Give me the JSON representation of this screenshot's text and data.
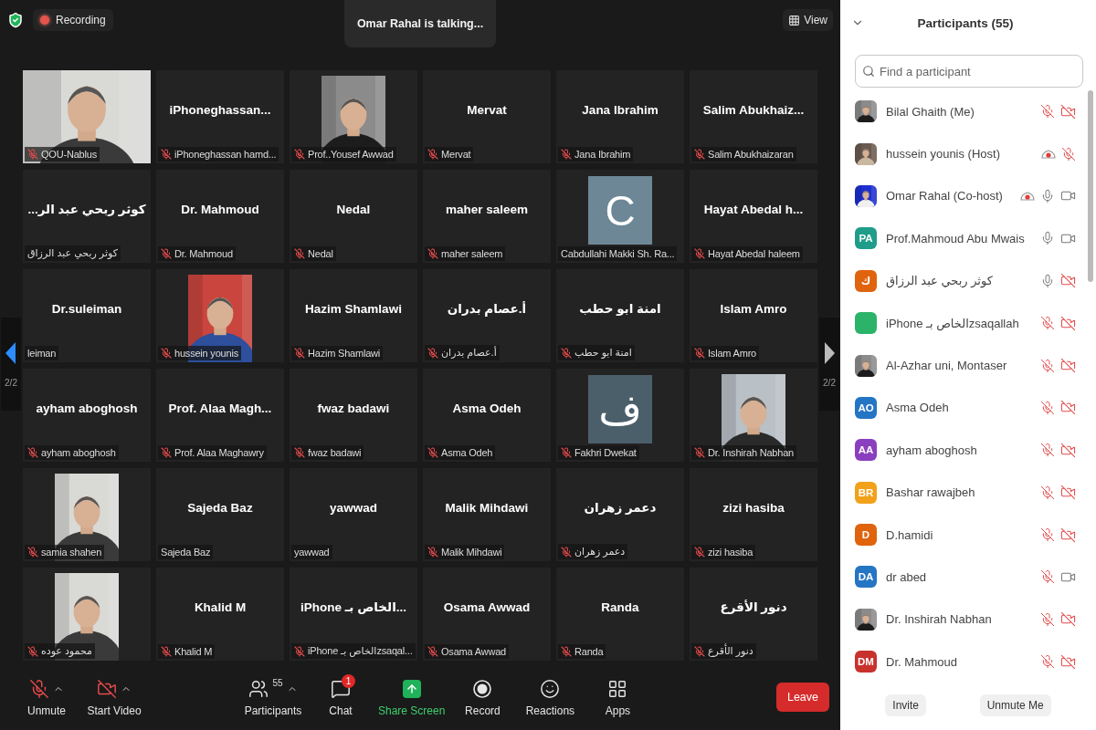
{
  "top_bar": {
    "recording": "Recording",
    "talking": "Omar Rahal is talking...",
    "view": "View"
  },
  "gallery": {
    "page_left": "2/2",
    "page_right": "2/2",
    "tiles": [
      {
        "kind": "video",
        "label": "QOU-Nablus",
        "muted": true
      },
      {
        "kind": "name",
        "title": "iPhoneghassan...",
        "label": "iPhoneghassan hamd...",
        "muted": true
      },
      {
        "label": "Prof..Yousef Awwad",
        "muted": true
      },
      {
        "kind": "name",
        "title": "Mervat",
        "label": "Mervat",
        "muted": true
      },
      {
        "kind": "name",
        "title": "Jana Ibrahim",
        "label": "Jana Ibrahim",
        "muted": true
      },
      {
        "kind": "name",
        "title": "Salim  Abukhaiz...",
        "label": "Salim Abukhaizaran",
        "muted": true
      },
      {
        "kind": "name",
        "title": "...كوثر ربحي عبد الر",
        "label": "كوثر ربحي عبد الرزاق",
        "muted": false
      },
      {
        "kind": "name",
        "title": "Dr. Mahmoud",
        "label": "Dr. Mahmoud",
        "muted": true
      },
      {
        "kind": "name",
        "title": "Nedal",
        "label": "Nedal",
        "muted": true
      },
      {
        "kind": "name",
        "title": "maher saleem",
        "label": "maher saleem",
        "muted": true
      },
      {
        "kind": "avatar",
        "letter": "C",
        "color": "#6e8796",
        "label": "Cabdullahi Makki Sh. Ra...",
        "muted": false
      },
      {
        "kind": "name",
        "title": "Hayat Abedal h...",
        "label": "Hayat Abedal haleem",
        "muted": true
      },
      {
        "kind": "name",
        "title": "Dr.suleiman",
        "label": "leiman",
        "muted": false
      },
      {
        "label": "hussein younis",
        "muted": true
      },
      {
        "kind": "name",
        "title": "Hazim Shamlawi",
        "label": "Hazim Shamlawi",
        "muted": true
      },
      {
        "kind": "name",
        "title": "أ.عصام بدران",
        "label": "أ.عصام بدران",
        "muted": true
      },
      {
        "kind": "name",
        "title": "امنة ابو حطب",
        "label": "امنة ابو حطب",
        "muted": true
      },
      {
        "kind": "name",
        "title": "Islam Amro",
        "label": "Islam Amro",
        "muted": true
      },
      {
        "kind": "name",
        "title": "ayham aboghosh",
        "label": "ayham aboghosh",
        "muted": true
      },
      {
        "kind": "name",
        "title": "Prof. Alaa  Magh...",
        "label": "Prof. Alaa Maghawry",
        "muted": true
      },
      {
        "kind": "name",
        "title": "fwaz badawi",
        "label": "fwaz badawi",
        "muted": true
      },
      {
        "kind": "name",
        "title": "Asma Odeh",
        "label": "Asma Odeh",
        "muted": true
      },
      {
        "kind": "avatar",
        "letter": "ف",
        "color": "#4b5f6b",
        "label": "Fakhri Dwekat",
        "muted": true
      },
      {
        "label": "Dr. Inshirah Nabhan",
        "muted": true
      },
      {
        "label": "samia shahen",
        "muted": true
      },
      {
        "kind": "name",
        "title": "Sajeda Baz",
        "label": "Sajeda Baz",
        "muted": false
      },
      {
        "kind": "name",
        "title": "yawwad",
        "label": "yawwad",
        "muted": false
      },
      {
        "kind": "name",
        "title": "Malik Mihdawi",
        "label": "Malik Mihdawi",
        "muted": true
      },
      {
        "kind": "name",
        "title": "دعمر زهران",
        "label": "دعمر زهران",
        "muted": true
      },
      {
        "kind": "name",
        "title": "zizi hasiba",
        "label": "zizi hasiba",
        "muted": true
      },
      {
        "label": "محمود عوده",
        "muted": true
      },
      {
        "kind": "name",
        "title": "Khalid M",
        "label": "Khalid M",
        "muted": true
      },
      {
        "kind": "name",
        "title": "iPhone الخاص بـ...",
        "label": "iPhone الخاص بـzsaqal...",
        "muted": true
      },
      {
        "kind": "name",
        "title": "Osama Awwad",
        "label": "Osama Awwad",
        "muted": true
      },
      {
        "kind": "name",
        "title": "Randa",
        "label": "Randa",
        "muted": true
      },
      {
        "kind": "name",
        "title": "دنور الأقرع",
        "label": "دنور الأقرع",
        "muted": true
      }
    ]
  },
  "toolbar": {
    "buttons": [
      {
        "kind": "audio",
        "label": "Unmute",
        "caret": true
      },
      {
        "kind": "video",
        "label": "Start Video",
        "caret": true
      },
      {
        "kind": "participants",
        "label": "Participants",
        "count": "55",
        "caret": true
      },
      {
        "kind": "chat",
        "label": "Chat",
        "badge": "1"
      },
      {
        "kind": "share",
        "label": "Share Screen"
      },
      {
        "kind": "record",
        "label": "Record"
      },
      {
        "kind": "reactions",
        "label": "Reactions"
      },
      {
        "kind": "apps",
        "label": "Apps"
      }
    ],
    "leave": "Leave"
  },
  "participants_panel": {
    "title": "Participants (55)",
    "search": {
      "placeholder": "Find a participant"
    },
    "people": [
      {
        "name": "Bilal Ghaith (Me)",
        "recording": false,
        "muted": true,
        "video_off": true
      },
      {
        "name": "hussein younis (Host)",
        "recording": true,
        "muted": true
      },
      {
        "name": "Omar Rahal (Co-host)",
        "recording": true,
        "muted": false,
        "video_off": false
      },
      {
        "name": "Prof.Mahmoud Abu Mwais",
        "kind": "initials",
        "initials": "PA",
        "color": "#1f9d8a",
        "recording": false,
        "muted": false,
        "video_off": false
      },
      {
        "name": "كوثر ربحي عبد الرزاق",
        "kind": "initials",
        "initials": "ك",
        "color": "#e0630d",
        "recording": false,
        "muted": false,
        "video_off": true
      },
      {
        "name": " iPhone الخاص بـzsaqallah",
        "kind": "initials",
        "color": "#2bb36a",
        "recording": false,
        "muted": true,
        "video_off": true
      },
      {
        "name": "Al-Azhar uni, Montaser",
        "recording": false,
        "muted": true,
        "video_off": true
      },
      {
        "name": "Asma Odeh",
        "kind": "initials",
        "initials": "AO",
        "color": "#2475c4",
        "recording": false,
        "muted": true,
        "video_off": true
      },
      {
        "name": "ayham aboghosh",
        "kind": "initials",
        "initials": "AA",
        "color": "#8a3fbf",
        "recording": false,
        "muted": true,
        "video_off": true
      },
      {
        "name": "Bashar rawajbeh",
        "kind": "initials",
        "initials": "BR",
        "color": "#f2a11a",
        "recording": false,
        "muted": true,
        "video_off": true
      },
      {
        "name": "D.hamidi",
        "kind": "initials",
        "initials": "D",
        "color": "#e0630d",
        "recording": false,
        "muted": true,
        "video_off": true
      },
      {
        "name": "dr abed",
        "kind": "initials",
        "initials": "DA",
        "color": "#2475c4",
        "recording": false,
        "muted": true,
        "video_off": false
      },
      {
        "name": "Dr. Inshirah Nabhan",
        "recording": false,
        "muted": true,
        "video_off": true
      },
      {
        "name": "Dr. Mahmoud",
        "kind": "initials",
        "initials": "DM",
        "color": "#c8322d",
        "recording": false,
        "muted": true,
        "video_off": true
      }
    ],
    "buttons": [
      "Invite",
      "Unmute Me"
    ]
  }
}
